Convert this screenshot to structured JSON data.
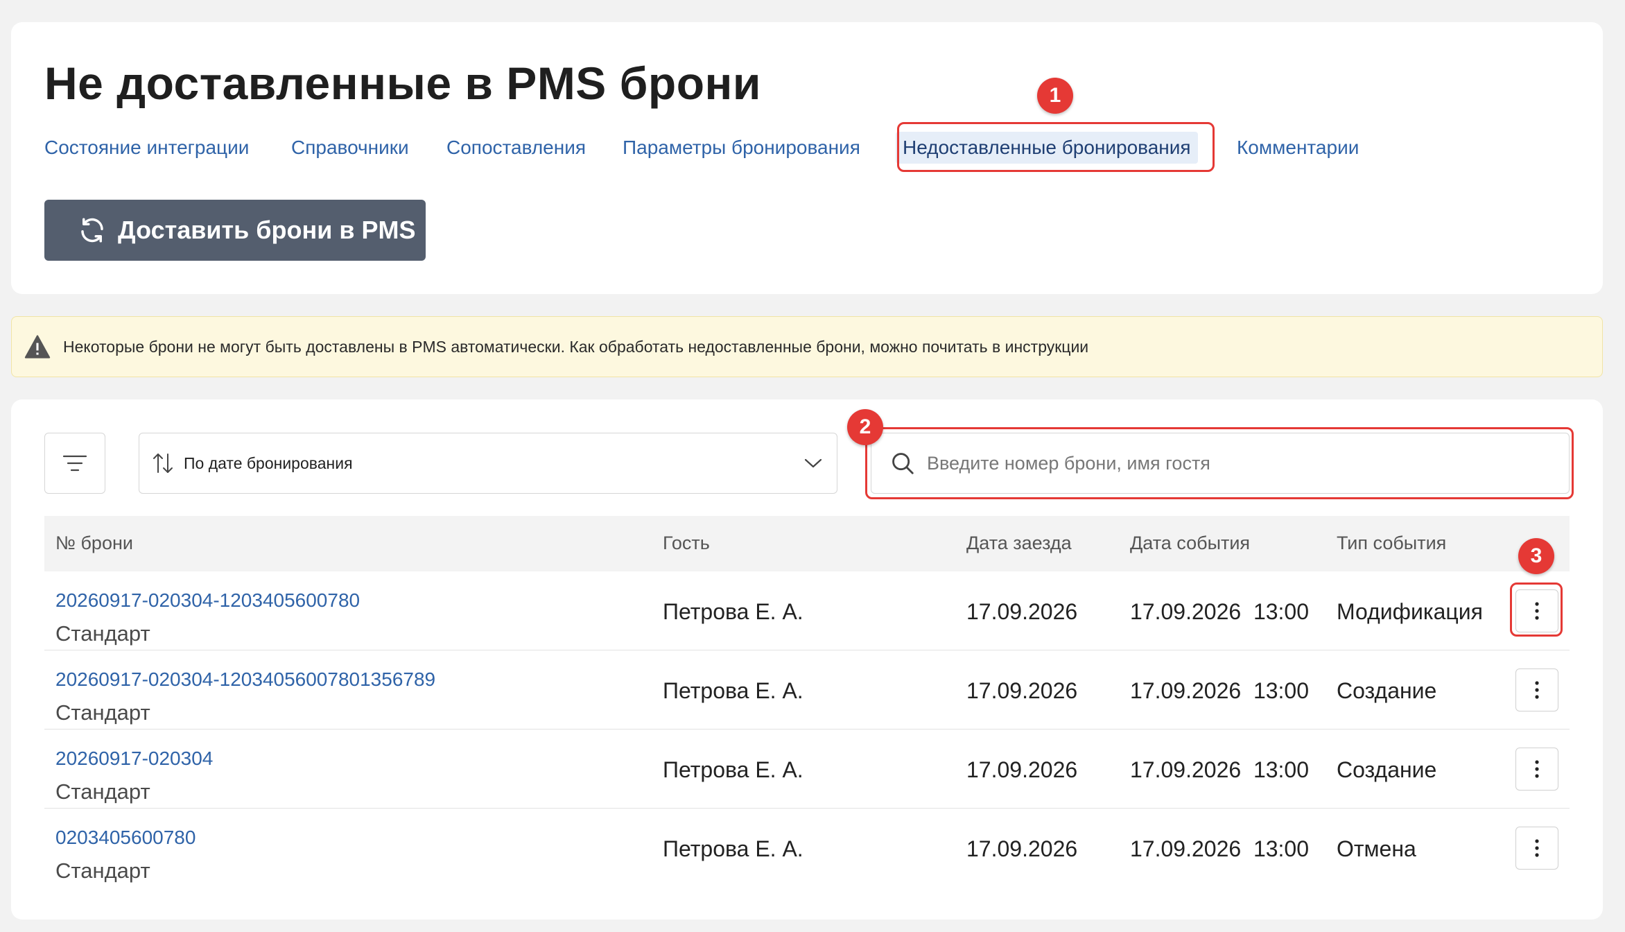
{
  "header": {
    "title": "Не доставленные в PMS брони"
  },
  "tabs": [
    {
      "label": "Состояние интеграции"
    },
    {
      "label": "Справочники"
    },
    {
      "label": "Сопоставления"
    },
    {
      "label": "Параметры бронирования"
    },
    {
      "label": "Недоставленные бронирования",
      "active": true
    },
    {
      "label": "Комментарии"
    }
  ],
  "toolbar": {
    "deliver_label": "Доставить брони в PMS"
  },
  "alert": {
    "text": "Некоторые брони не могут быть доставлены в PMS автоматически. Как обработать недоставленные брони, можно почитать в инструкции"
  },
  "filters": {
    "sort_label": "По дате бронирования",
    "search_placeholder": "Введите номер брони, имя гостя"
  },
  "annotations": {
    "badge1": "1",
    "badge2": "2",
    "badge3": "3"
  },
  "table": {
    "columns": [
      "№ брони",
      "Гость",
      "Дата заезда",
      "Дата события",
      "Тип события"
    ],
    "rows": [
      {
        "number": "20260917-020304-1203405600780",
        "category": "Стандарт",
        "guest": "Петрова Е. А.",
        "checkin": "17.09.2026",
        "event_date": "17.09.2026  13:00",
        "event_type": "Модификация"
      },
      {
        "number": "20260917-020304-12034056007801356789",
        "category": "Стандарт",
        "guest": "Петрова Е. А.",
        "checkin": "17.09.2026",
        "event_date": "17.09.2026  13:00",
        "event_type": "Создание"
      },
      {
        "number": "20260917-020304",
        "category": "Стандарт",
        "guest": "Петрова Е. А.",
        "checkin": "17.09.2026",
        "event_date": "17.09.2026  13:00",
        "event_type": "Создание"
      },
      {
        "number": "0203405600780",
        "category": "Стандарт",
        "guest": "Петрова Е. А.",
        "checkin": "17.09.2026",
        "event_date": "17.09.2026  13:00",
        "event_type": "Отмена"
      }
    ]
  },
  "colors": {
    "accent_link": "#2f63a8",
    "button_bg": "#545e6e",
    "annotation_red": "#e53935",
    "alert_bg": "#fdf8df"
  },
  "icons": {
    "deliver_button": "refresh-icon",
    "alert": "warning-icon",
    "filter": "filter-icon",
    "sort": "sort-icon",
    "select": "chevron-down-icon",
    "search": "search-icon",
    "row_actions": "more-vertical-icon"
  }
}
